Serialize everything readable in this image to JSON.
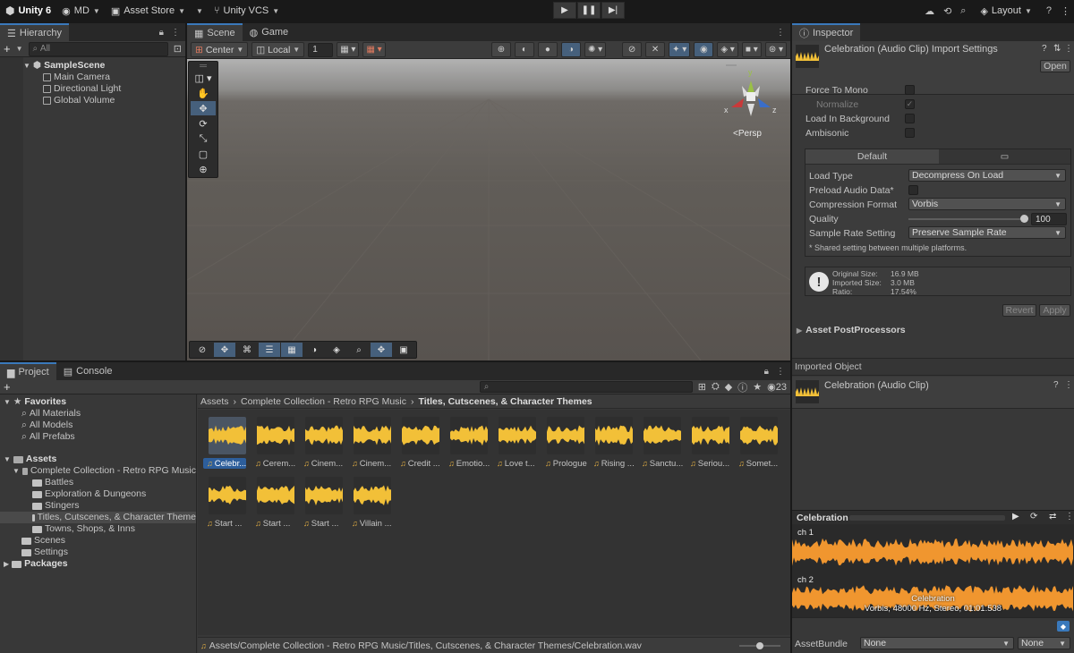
{
  "topbar": {
    "app": "Unity 6",
    "account": "MD",
    "asset_store": "Asset Store",
    "vcs": "Unity VCS",
    "layout": "Layout"
  },
  "hierarchy": {
    "tab": "Hierarchy",
    "search_placeholder": "All",
    "scene": "SampleScene",
    "items": [
      "Main Camera",
      "Directional Light",
      "Global Volume"
    ]
  },
  "scene_view": {
    "tabs": [
      "Scene",
      "Game"
    ],
    "pivot": "Center",
    "space": "Local",
    "grid_value": "1",
    "persp": "Persp",
    "axes": {
      "x": "x",
      "y": "y",
      "z": "z"
    }
  },
  "inspector": {
    "tab": "Inspector",
    "title": "Celebration (Audio Clip) Import Settings",
    "open_btn": "Open",
    "force_to_mono": "Force To Mono",
    "normalize": "Normalize",
    "load_in_background": "Load In Background",
    "ambisonic": "Ambisonic",
    "platform_default": "Default",
    "load_type_label": "Load Type",
    "load_type": "Decompress On Load",
    "preload_label": "Preload Audio Data*",
    "compression_label": "Compression Format",
    "compression": "Vorbis",
    "quality_label": "Quality",
    "quality": "100",
    "quality_fraction": 1.0,
    "sample_rate_label": "Sample Rate Setting",
    "sample_rate": "Preserve Sample Rate",
    "shared_note": "* Shared setting between multiple platforms.",
    "original_size_label": "Original Size:",
    "original_size": "16.9 MB",
    "imported_size_label": "Imported Size:",
    "imported_size": "3.0 MB",
    "ratio_label": "Ratio:",
    "ratio": "17.54%",
    "revert": "Revert",
    "apply": "Apply",
    "postprocessors": "Asset PostProcessors",
    "imported_object": "Imported Object",
    "clip_name": "Celebration (Audio Clip)",
    "preview_title": "Celebration",
    "ch1": "ch 1",
    "ch2": "ch 2",
    "clip_caption": "Celebration",
    "clip_info": "Vorbis, 48000 Hz, Stereo, 01:01.538",
    "assetbundle_label": "AssetBundle",
    "assetbundle": "None",
    "variant": "None",
    "accent": "#f0962f"
  },
  "project": {
    "tabs": [
      "Project",
      "Console"
    ],
    "count": "23",
    "favorites": "Favorites",
    "favorite_items": [
      "All Materials",
      "All Models",
      "All Prefabs"
    ],
    "assets": "Assets",
    "collection": "Complete Collection - Retro RPG Music",
    "collection_children": [
      "Battles",
      "Exploration & Dungeons",
      "Stingers",
      "Titles, Cutscenes, & Character Theme",
      "Towns, Shops, & Inns"
    ],
    "other_folders": [
      "Scenes",
      "Settings"
    ],
    "packages": "Packages",
    "breadcrumb": [
      "Assets",
      "Complete Collection - Retro RPG Music",
      "Titles, Cutscenes, & Character Themes"
    ],
    "files": [
      "Celebr...",
      "Cerem...",
      "Cinem...",
      "Cinem...",
      "Credit ...",
      "Emotio...",
      "Love t...",
      "Prologue",
      "Rising ...",
      "Sanctu...",
      "Seriou...",
      "Somet...",
      "Start ...",
      "Start ...",
      "Start ...",
      "Villain ..."
    ],
    "status_path": "Assets/Complete Collection - Retro RPG Music/Titles, Cutscenes, & Character Themes/Celebration.wav",
    "wave_color": "#f2c038"
  }
}
